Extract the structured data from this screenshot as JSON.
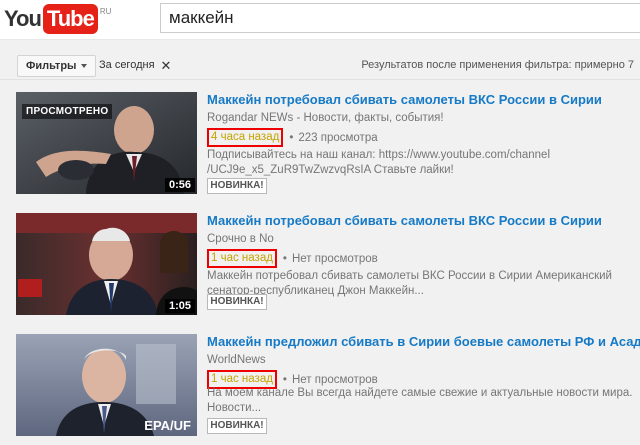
{
  "header": {
    "logo_you": "You",
    "logo_tube": "Tube",
    "logo_region": "RU",
    "search_query": "маккейн"
  },
  "filterbar": {
    "filters_label": "Фильтры",
    "chip_label": "За сегодня",
    "chip_close": "✕",
    "results_text": "Результатов после применения фильтра: примерно 7"
  },
  "results": [
    {
      "title": "Маккейн потребовал сбивать самолеты ВКС России в Сирии",
      "channel": "Rogandar NEWs - Новости, факты, события!",
      "time": "4 часа назад",
      "views": "223 просмотра",
      "desc_line1": "Подписывайтесь на наш канал: https://www.youtube.com/channel",
      "desc_line2": "/UCJ9e_x5_ZuR9TwZwzvqRsIA Ставьте лайки!",
      "badge": "НОВИНКА!",
      "duration": "0:56",
      "watched": "ПРОСМОТРЕНО"
    },
    {
      "title": "Маккейн потребовал сбивать самолеты ВКС России в Сирии",
      "channel": "Срочно в No",
      "time": "1 час назад",
      "views": "Нет просмотров",
      "desc_line1": "Маккейн потребовал сбивать самолеты ВКС России в Сирии Американский",
      "desc_line2": "сенатор-республиканец Джон Маккейн...",
      "badge": "НОВИНКА!",
      "duration": "1:05"
    },
    {
      "title": "Маккейн предложил сбивать в Сирии боевые самолеты РФ и Асада",
      "channel": "WorldNews",
      "time": "1 час назад",
      "views": "Нет просмотров",
      "desc_line1": "На моем канале Вы всегда найдете самые свежие и актуальные новости мира.",
      "desc_line2": "Новости...",
      "badge": "НОВИНКА!",
      "watermark": "EPA/UF"
    }
  ],
  "colors": {
    "link": "#167ac6",
    "highlight_box": "#e00000",
    "time_text": "#c6a200",
    "logo_red": "#e62117"
  }
}
